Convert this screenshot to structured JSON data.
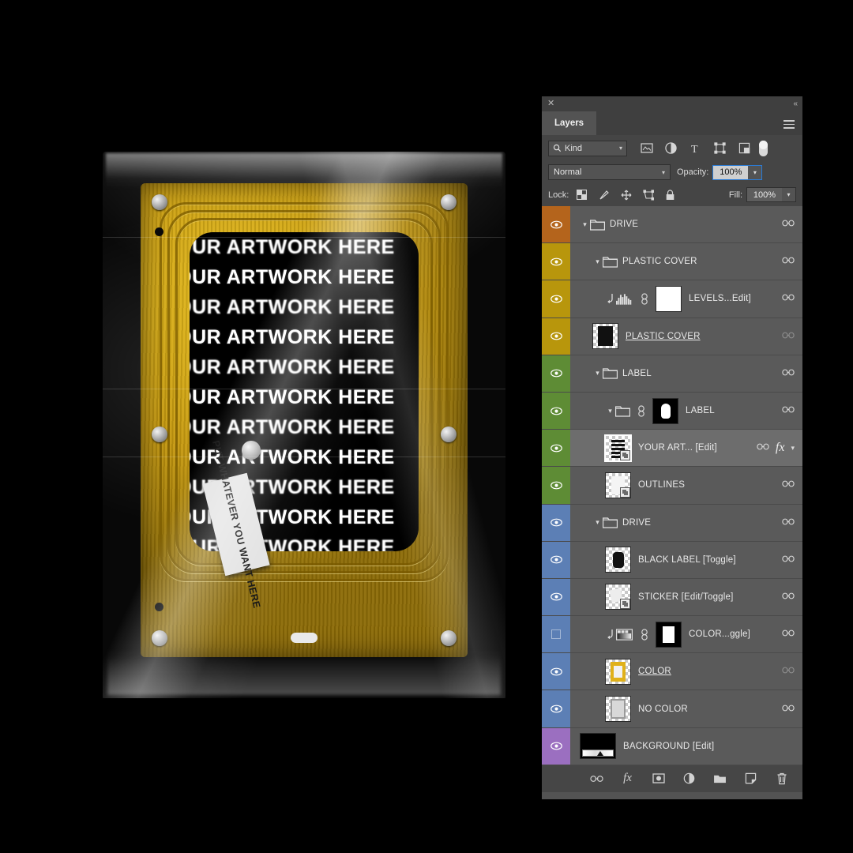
{
  "artwork": {
    "repeat_text": "YOUR ARTWORK HERE",
    "lines": [
      "YOUR ARTWORK HERE",
      "YOUR ARTWORK HERE",
      "YOUR ARTWORK HERE",
      "YOUR ARTWORK HERE",
      "YOUR ARTWORK HERE",
      "YOUR ARTWORK HERE",
      "YOUR ARTWORK HERE",
      "YOUR ARTWORK HERE",
      "YOUR ARTWORK HERE",
      "YOUR ARTWORK HERE",
      "YOUR ARTWORK HERE",
      "YOUR ARTWORK HERE"
    ],
    "sticker_text": "PUT WHATEVER YOU WANT HERE",
    "colors": {
      "gold": "#d8a814",
      "background": "#000000",
      "window": "#000000"
    }
  },
  "panel": {
    "close_label": "✕",
    "collapse_label": "«",
    "tab_label": "Layers",
    "menu_label": "panel-menu",
    "filter": {
      "kind_label": "Kind",
      "search_icon": "search-icon",
      "icons": [
        "pixel-layer-filter-icon",
        "adjustment-layer-filter-icon",
        "type-layer-filter-icon",
        "shape-layer-filter-icon",
        "smart-object-filter-icon"
      ],
      "toggle_name": "filter-enable-toggle"
    },
    "blend": {
      "mode": "Normal",
      "opacity_label": "Opacity:",
      "opacity_value": "100%",
      "fill_label": "Fill:",
      "fill_value": "100%"
    },
    "lock": {
      "label": "Lock:",
      "icons": [
        "lock-transparent-pixels-icon",
        "lock-image-pixels-icon",
        "lock-position-icon",
        "lock-artboard-nesting-icon",
        "lock-all-icon"
      ]
    },
    "layers": [
      {
        "name": "DRIVE",
        "swatch": "#b4641c",
        "visible": true,
        "type": "group",
        "indent": 1,
        "expanded": true,
        "thumb": "folder",
        "chain": true,
        "chain_dim": false,
        "selected": false,
        "underline": false,
        "fx": false
      },
      {
        "name": "PLASTIC COVER",
        "swatch": "#b8960c",
        "visible": true,
        "type": "group",
        "indent": 2,
        "expanded": true,
        "thumb": "folder",
        "chain": true,
        "chain_dim": false,
        "selected": false,
        "underline": false,
        "fx": false
      },
      {
        "name": "LEVELS...Edit]",
        "swatch": "#b8960c",
        "visible": true,
        "type": "adjustment-levels",
        "indent": 3,
        "clipped": true,
        "thumb": "white-mask",
        "chain": true,
        "chain_dim": false,
        "selected": false,
        "underline": false,
        "fx": false
      },
      {
        "name": "PLASTIC COVER ",
        "swatch": "#b8960c",
        "visible": true,
        "type": "pixel",
        "indent": 2,
        "thumb": "plastic",
        "chain": true,
        "chain_dim": true,
        "selected": false,
        "underline": true,
        "fx": false
      },
      {
        "name": "LABEL",
        "swatch": "#5e8c35",
        "visible": true,
        "type": "group",
        "indent": 2,
        "expanded": true,
        "thumb": "folder",
        "chain": true,
        "chain_dim": false,
        "selected": false,
        "underline": false,
        "fx": false
      },
      {
        "name": "LABEL",
        "swatch": "#5e8c35",
        "visible": true,
        "type": "group-masked",
        "indent": 3,
        "expanded": true,
        "thumb": "black-mask-blob",
        "chain": true,
        "chain_dim": false,
        "selected": false,
        "underline": false,
        "fx": false
      },
      {
        "name": "YOUR ART... [Edit]",
        "swatch": "#5e8c35",
        "visible": true,
        "type": "smart-object",
        "indent": 3,
        "thumb": "artwork-so",
        "chain": true,
        "chain_dim": false,
        "selected": true,
        "underline": false,
        "fx": true
      },
      {
        "name": "OUTLINES",
        "swatch": "#5e8c35",
        "visible": true,
        "type": "smart-object",
        "indent": 3,
        "thumb": "outlines-so",
        "chain": true,
        "chain_dim": false,
        "selected": false,
        "underline": false,
        "fx": false
      },
      {
        "name": "DRIVE",
        "swatch": "#5c7fb5",
        "visible": true,
        "type": "group",
        "indent": 2,
        "expanded": true,
        "thumb": "folder",
        "chain": true,
        "chain_dim": false,
        "selected": false,
        "underline": false,
        "fx": false
      },
      {
        "name": "BLACK LABEL [Toggle]",
        "swatch": "#5c7fb5",
        "visible": true,
        "type": "pixel",
        "indent": 3,
        "thumb": "black-label",
        "chain": true,
        "chain_dim": false,
        "selected": false,
        "underline": false,
        "fx": false
      },
      {
        "name": "STICKER [Edit/Toggle]",
        "swatch": "#5c7fb5",
        "visible": true,
        "type": "smart-object",
        "indent": 3,
        "thumb": "sticker-so",
        "chain": true,
        "chain_dim": false,
        "selected": false,
        "underline": false,
        "fx": false
      },
      {
        "name": "COLOR...ggle]",
        "swatch": "#5c7fb5",
        "visible": false,
        "type": "adjustment-gradient",
        "indent": 3,
        "clipped": true,
        "thumb": "black-mask-rect",
        "chain": true,
        "chain_dim": false,
        "selected": false,
        "underline": false,
        "fx": false
      },
      {
        "name": "COLOR",
        "swatch": "#5c7fb5",
        "visible": true,
        "type": "pixel",
        "indent": 3,
        "thumb": "color-gold",
        "chain": true,
        "chain_dim": true,
        "selected": false,
        "underline": true,
        "fx": false
      },
      {
        "name": "NO COLOR",
        "swatch": "#5c7fb5",
        "visible": true,
        "type": "pixel",
        "indent": 3,
        "thumb": "no-color-grey",
        "chain": true,
        "chain_dim": false,
        "selected": false,
        "underline": false,
        "fx": false
      },
      {
        "name": "BACKGROUND [Edit]",
        "swatch": "#9b6fc0",
        "visible": true,
        "type": "gradient-fill",
        "indent": 1,
        "thumb": "gradient",
        "chain": false,
        "chain_dim": false,
        "selected": false,
        "underline": false,
        "fx": false
      }
    ],
    "bottom_icons": [
      "link-layers-icon",
      "layer-style-fx-icon",
      "add-layer-mask-icon",
      "new-adjustment-layer-icon",
      "new-group-icon",
      "new-layer-icon",
      "delete-layer-icon"
    ]
  }
}
